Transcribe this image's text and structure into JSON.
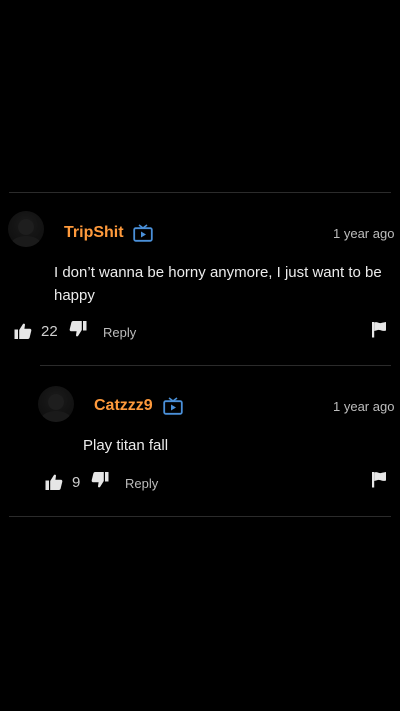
{
  "comments": [
    {
      "username": "TripShit",
      "timestamp": "1 year ago",
      "text": "I don’t wanna be horny anymore, I just want to be happy",
      "likes": "22",
      "reply_label": "Reply"
    },
    {
      "username": "Catzzz9",
      "timestamp": "1 year ago",
      "text": "Play titan fall",
      "likes": "9",
      "reply_label": "Reply"
    }
  ],
  "colors": {
    "background": "#000000",
    "username": "#ff9a3c",
    "badge": "#4a90d9",
    "text": "#ececec",
    "muted": "#bdbdbd",
    "divider": "#2b2b2b"
  },
  "icons": {
    "badge": "tv-icon",
    "like": "thumbs-up-icon",
    "dislike": "thumbs-down-icon",
    "report": "flag-icon"
  }
}
